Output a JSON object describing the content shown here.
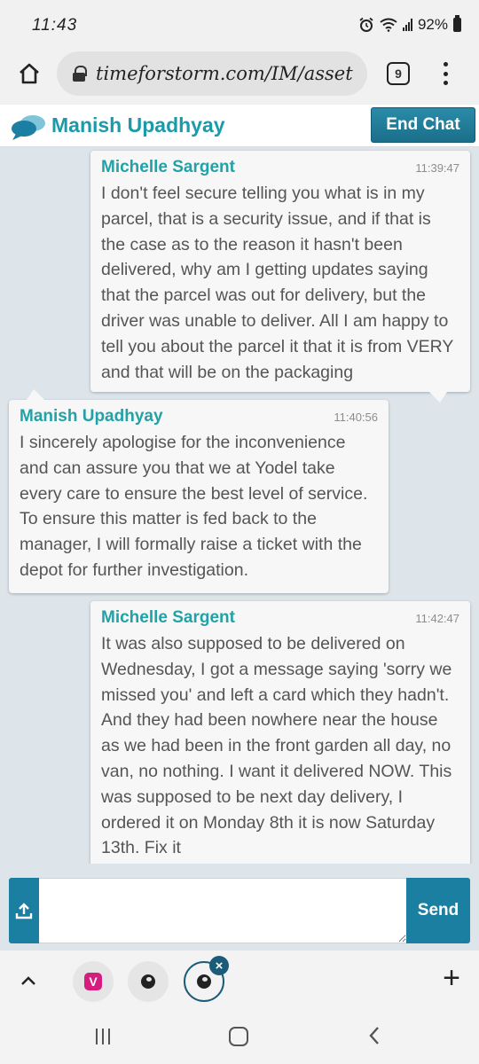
{
  "status_bar": {
    "time": "11:43",
    "battery": "92%"
  },
  "browser": {
    "url": "timeforstorm.com/IM/asset",
    "tab_count": "9"
  },
  "chat": {
    "agent_name": "Manish Upadhyay",
    "end_chat_label": "End Chat",
    "accent_color": "#1b9aaa",
    "button_color": "#1b7fa1"
  },
  "messages": [
    {
      "sender": "Michelle Sargent",
      "time": "11:39:47",
      "side": "right",
      "text": "I don't feel secure telling you what is in my parcel, that is a security issue, and if that is the case as to the reason it hasn't been delivered, why am I getting updates saying that the parcel was out for delivery, but the driver was unable to deliver. All I am happy to tell you about the parcel it that it is from VERY and that will be on the packaging"
    },
    {
      "sender": "Manish Upadhyay",
      "time": "11:40:56",
      "side": "left",
      "text": "I sincerely apologise for the inconvenience and can assure you that we at Yodel take every care to ensure the best level of service. To ensure this matter is fed back to the manager, I will formally raise a ticket with the depot for further investigation."
    },
    {
      "sender": "Michelle Sargent",
      "time": "11:42:47",
      "side": "right",
      "text": "It was also supposed to be delivered on Wednesday, I got a message saying 'sorry we missed you' and left a card which they hadn't. And they had been nowhere near the house as we had been in the front garden all day, no van, no nothing. I want it delivered NOW. This was supposed to be next day delivery, I ordered it on Monday 8th it is now Saturday 13th. Fix it"
    }
  ],
  "composer": {
    "input_value": "",
    "input_placeholder": "",
    "send_label": "Send",
    "upload_icon": "upload-icon"
  },
  "tab_bar": {
    "first_tab_badge": "V",
    "close_icon_glyph": "×",
    "plus_glyph": "+"
  }
}
